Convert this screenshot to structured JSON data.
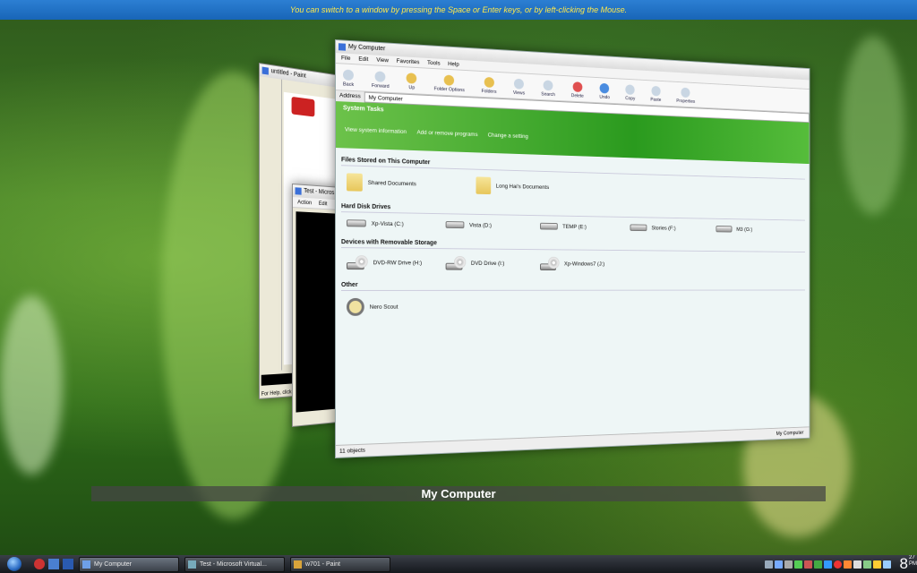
{
  "hint": "You can switch to a window by pressing the Space or Enter keys, or by left-clicking the Mouse.",
  "caption": "My Computer",
  "paint_window": {
    "title": "untitled - Paint",
    "status": "For Help, click H"
  },
  "test_window": {
    "title": "Test - Micros",
    "menu": [
      "Action",
      "Edit"
    ]
  },
  "mycomputer_window": {
    "title": "My Computer",
    "menu": [
      "File",
      "Edit",
      "View",
      "Favorites",
      "Tools",
      "Help"
    ],
    "toolbar": [
      "Back",
      "Forward",
      "Up",
      "Folder Options",
      "Folders",
      "Views",
      "Search",
      "Delete",
      "Undo",
      "Copy",
      "Paste",
      "Properties"
    ],
    "address_label": "Address",
    "address_value": "My Computer",
    "system_tasks": {
      "title": "System Tasks",
      "links": [
        "View system information",
        "Add or remove programs",
        "Change a setting"
      ]
    },
    "sections": [
      {
        "title": "Files Stored on This Computer",
        "items": [
          {
            "label": "Shared Documents",
            "icon": "folder-icon"
          },
          {
            "label": "Long Hai's Documents",
            "icon": "folder-icon"
          }
        ]
      },
      {
        "title": "Hard Disk Drives",
        "items": [
          {
            "label": "Xp-Vista (C:)",
            "icon": "hard-drive-icon"
          },
          {
            "label": "Vista (D:)",
            "icon": "hard-drive-icon"
          },
          {
            "label": "TEMP (E:)",
            "icon": "hard-drive-icon"
          },
          {
            "label": "Stories (F:)",
            "icon": "hard-drive-icon"
          },
          {
            "label": "M3 (G:)",
            "icon": "hard-drive-icon"
          }
        ]
      },
      {
        "title": "Devices with Removable Storage",
        "items": [
          {
            "label": "DVD-RW Drive (H:)",
            "icon": "dvd-drive-icon"
          },
          {
            "label": "DVD Drive (I:)",
            "icon": "dvd-drive-icon"
          },
          {
            "label": "Xp-Windows7 (J:)",
            "icon": "dvd-drive-icon"
          }
        ]
      },
      {
        "title": "Other",
        "items": [
          {
            "label": "Nero Scout",
            "icon": "nero-scout-icon"
          }
        ]
      }
    ],
    "status": "11 objects",
    "status_right": "My Computer"
  },
  "taskbar": {
    "buttons": [
      "My Computer",
      "Test - Microsoft Virtual...",
      "w701 - Paint"
    ],
    "clock_hour": "8",
    "clock_minute": "27",
    "clock_ampm": "PM"
  }
}
